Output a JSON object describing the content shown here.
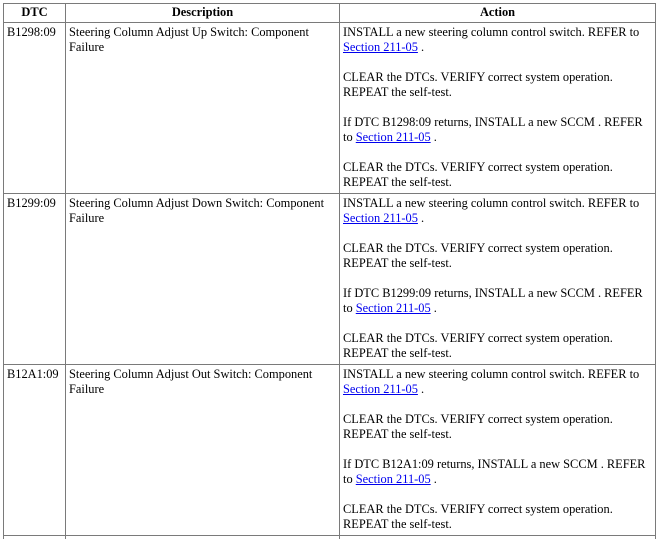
{
  "table": {
    "headers": {
      "dtc": "DTC",
      "description": "Description",
      "action": "Action"
    },
    "rows": [
      {
        "dtc": "B1298:09",
        "description": "Steering Column Adjust Up Switch: Component Failure",
        "steps": [
          {
            "text": "INSTALL a new steering column control switch. REFER to ",
            "link": "Section 211-05",
            "tail": " ."
          },
          {
            "text": "CLEAR the DTCs. VERIFY correct system operation. REPEAT the self-test.",
            "link": "",
            "tail": ""
          },
          {
            "text": "If DTC B1298:09 returns, INSTALL a new SCCM . REFER to ",
            "link": "Section 211-05",
            "tail": " ."
          },
          {
            "text": "CLEAR the DTCs. VERIFY correct system operation. REPEAT the self-test.",
            "link": "",
            "tail": ""
          }
        ]
      },
      {
        "dtc": "B1299:09",
        "description": "Steering Column Adjust Down Switch: Component Failure",
        "steps": [
          {
            "text": "INSTALL a new steering column control switch. REFER to ",
            "link": "Section 211-05",
            "tail": " ."
          },
          {
            "text": "CLEAR the DTCs. VERIFY correct system operation. REPEAT the self-test.",
            "link": "",
            "tail": ""
          },
          {
            "text": "If DTC B1299:09 returns, INSTALL a new SCCM . REFER to ",
            "link": "Section 211-05",
            "tail": " ."
          },
          {
            "text": "CLEAR the DTCs. VERIFY correct system operation. REPEAT the self-test.",
            "link": "",
            "tail": ""
          }
        ]
      },
      {
        "dtc": "B12A1:09",
        "description": "Steering Column Adjust Out Switch: Component Failure",
        "steps": [
          {
            "text": "INSTALL a new steering column control switch. REFER to ",
            "link": "Section 211-05",
            "tail": " ."
          },
          {
            "text": "CLEAR the DTCs. VERIFY correct system operation. REPEAT the self-test.",
            "link": "",
            "tail": ""
          },
          {
            "text": "If DTC B12A1:09 returns, INSTALL a new SCCM . REFER to ",
            "link": "Section 211-05",
            "tail": " ."
          },
          {
            "text": "CLEAR the DTCs. VERIFY correct system operation. REPEAT the self-test.",
            "link": "",
            "tail": ""
          }
        ]
      }
    ]
  }
}
